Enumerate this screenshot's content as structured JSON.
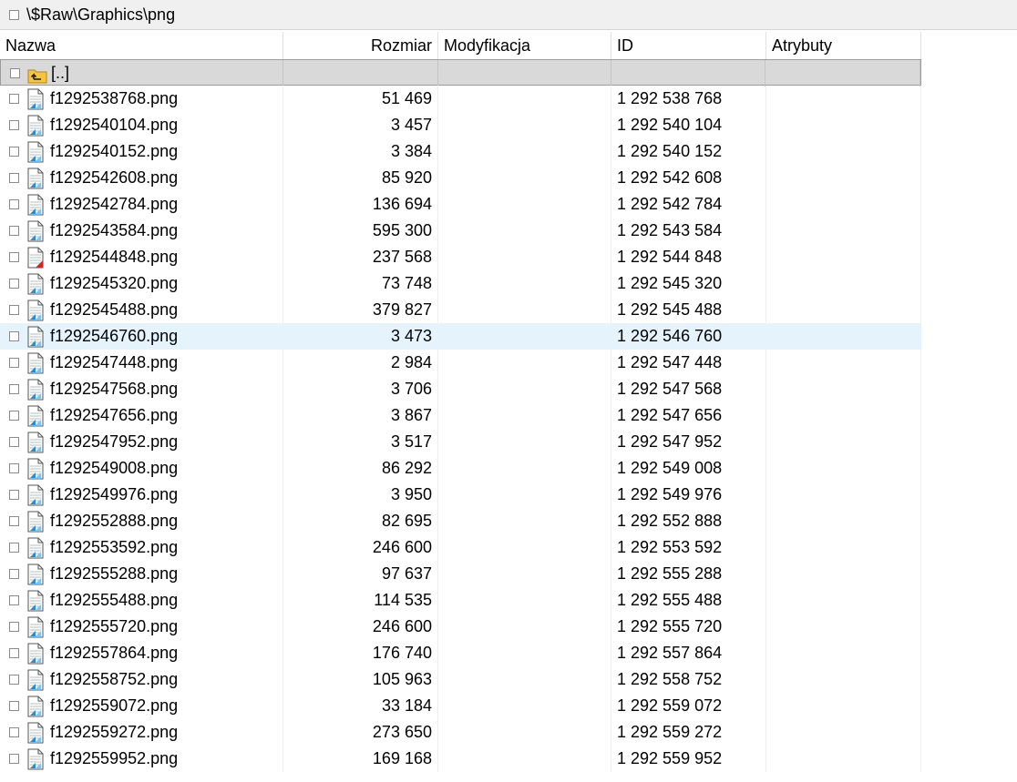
{
  "path": "\\$Raw\\Graphics\\png",
  "columns": {
    "name": "Nazwa",
    "size": "Rozmiar",
    "modified": "Modyfikacja",
    "id": "ID",
    "attributes": "Atrybuty"
  },
  "parent": {
    "label": "[..]",
    "icon": "folder-up-icon"
  },
  "hover_row": 9,
  "files": [
    {
      "name": "f1292538768.png",
      "size": "51 469",
      "id": "1 292 538 768",
      "icon": "png-file-icon"
    },
    {
      "name": "f1292540104.png",
      "size": "3 457",
      "id": "1 292 540 104",
      "icon": "png-file-icon"
    },
    {
      "name": "f1292540152.png",
      "size": "3 384",
      "id": "1 292 540 152",
      "icon": "png-file-icon"
    },
    {
      "name": "f1292542608.png",
      "size": "85 920",
      "id": "1 292 542 608",
      "icon": "png-file-icon"
    },
    {
      "name": "f1292542784.png",
      "size": "136 694",
      "id": "1 292 542 784",
      "icon": "png-file-icon"
    },
    {
      "name": "f1292543584.png",
      "size": "595 300",
      "id": "1 292 543 584",
      "icon": "png-file-icon"
    },
    {
      "name": "f1292544848.png",
      "size": "237 568",
      "id": "1 292 544 848",
      "icon": "damaged-file-icon"
    },
    {
      "name": "f1292545320.png",
      "size": "73 748",
      "id": "1 292 545 320",
      "icon": "png-file-icon"
    },
    {
      "name": "f1292545488.png",
      "size": "379 827",
      "id": "1 292 545 488",
      "icon": "png-file-icon"
    },
    {
      "name": "f1292546760.png",
      "size": "3 473",
      "id": "1 292 546 760",
      "icon": "png-file-icon"
    },
    {
      "name": "f1292547448.png",
      "size": "2 984",
      "id": "1 292 547 448",
      "icon": "png-file-icon"
    },
    {
      "name": "f1292547568.png",
      "size": "3 706",
      "id": "1 292 547 568",
      "icon": "png-file-icon"
    },
    {
      "name": "f1292547656.png",
      "size": "3 867",
      "id": "1 292 547 656",
      "icon": "png-file-icon"
    },
    {
      "name": "f1292547952.png",
      "size": "3 517",
      "id": "1 292 547 952",
      "icon": "png-file-icon"
    },
    {
      "name": "f1292549008.png",
      "size": "86 292",
      "id": "1 292 549 008",
      "icon": "png-file-icon"
    },
    {
      "name": "f1292549976.png",
      "size": "3 950",
      "id": "1 292 549 976",
      "icon": "png-file-icon"
    },
    {
      "name": "f1292552888.png",
      "size": "82 695",
      "id": "1 292 552 888",
      "icon": "png-file-icon"
    },
    {
      "name": "f1292553592.png",
      "size": "246 600",
      "id": "1 292 553 592",
      "icon": "png-file-icon"
    },
    {
      "name": "f1292555288.png",
      "size": "97 637",
      "id": "1 292 555 288",
      "icon": "png-file-icon"
    },
    {
      "name": "f1292555488.png",
      "size": "114 535",
      "id": "1 292 555 488",
      "icon": "png-file-icon"
    },
    {
      "name": "f1292555720.png",
      "size": "246 600",
      "id": "1 292 555 720",
      "icon": "png-file-icon"
    },
    {
      "name": "f1292557864.png",
      "size": "176 740",
      "id": "1 292 557 864",
      "icon": "png-file-icon"
    },
    {
      "name": "f1292558752.png",
      "size": "105 963",
      "id": "1 292 558 752",
      "icon": "png-file-icon"
    },
    {
      "name": "f1292559072.png",
      "size": "33 184",
      "id": "1 292 559 072",
      "icon": "png-file-icon"
    },
    {
      "name": "f1292559272.png",
      "size": "273 650",
      "id": "1 292 559 272",
      "icon": "png-file-icon"
    },
    {
      "name": "f1292559952.png",
      "size": "169 168",
      "id": "1 292 559 952",
      "icon": "png-file-icon"
    }
  ],
  "colors": {
    "hover": "#e5f3fd",
    "parent_row": "#d9d9d9",
    "icon_accent": "#1f8ed6",
    "damaged_accent": "#e02020",
    "folder": "#f5c542"
  }
}
